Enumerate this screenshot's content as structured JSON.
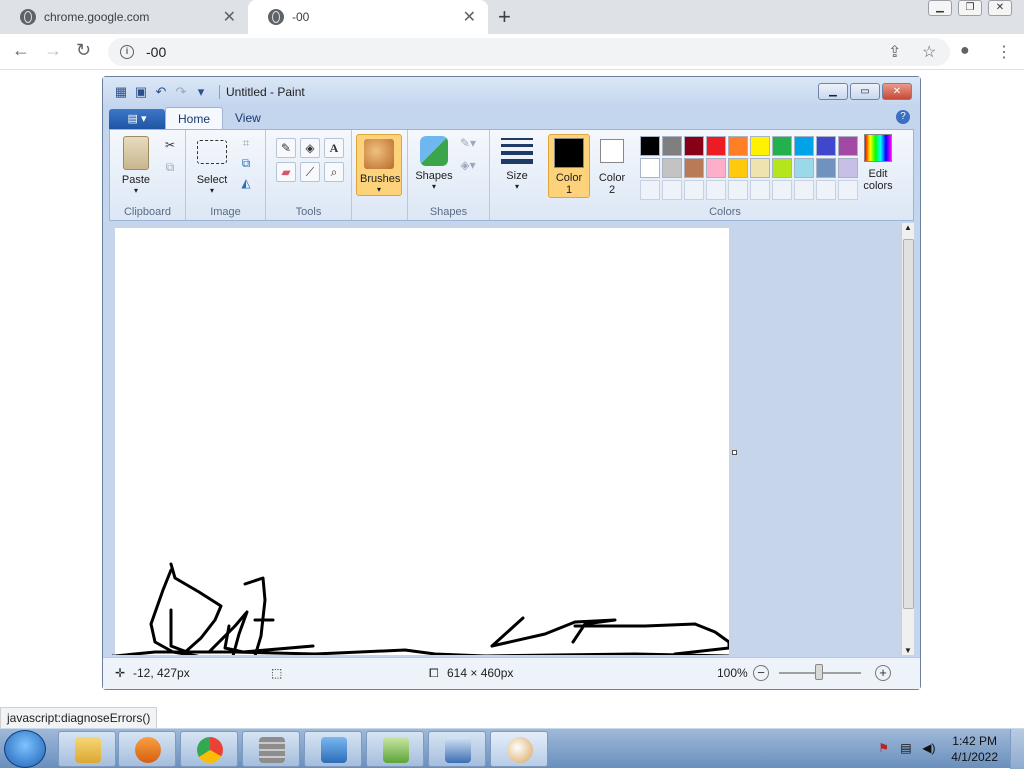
{
  "browser": {
    "tabs": [
      {
        "title": "chrome.google.com"
      },
      {
        "title": "-00"
      }
    ],
    "address": "-00"
  },
  "paint": {
    "title": "Untitled - Paint",
    "ribbon_tabs": [
      "Home",
      "View"
    ],
    "groups": {
      "clipboard": {
        "label": "Clipboard",
        "paste": "Paste"
      },
      "image": {
        "label": "Image",
        "select": "Select"
      },
      "tools": {
        "label": "Tools"
      },
      "brushes": {
        "label": "Brushes"
      },
      "shapes": {
        "label": "Shapes",
        "button": "Shapes"
      },
      "size": {
        "label": "Size"
      },
      "colors": {
        "label": "Colors",
        "color1": "Color\n1",
        "color1_line1": "Color",
        "color1_line2": "1",
        "color2_line1": "Color",
        "color2_line2": "2",
        "edit_line1": "Edit",
        "edit_line2": "colors",
        "palette_row1": [
          "#000000",
          "#7f7f7f",
          "#880015",
          "#ed1c24",
          "#ff7f27",
          "#fff200",
          "#22b14c",
          "#00a2e8",
          "#3f48cc",
          "#a349a4"
        ],
        "palette_row2": [
          "#ffffff",
          "#c3c3c3",
          "#b97a57",
          "#ffaec9",
          "#ffc90e",
          "#efe4b0",
          "#b5e61d",
          "#99d9ea",
          "#7092be",
          "#c8bfe7"
        ]
      }
    },
    "status": {
      "position": "-12, 427px",
      "size": "614 × 460px",
      "zoom": "100%"
    }
  },
  "browser_status": "javascript:diagnoseErrors()",
  "taskbar": {
    "time": "1:42 PM",
    "date": "4/1/2022"
  },
  "colors": {
    "ribbon_accent": "#fcd27a",
    "paint_frame": "#c4d6ee"
  }
}
